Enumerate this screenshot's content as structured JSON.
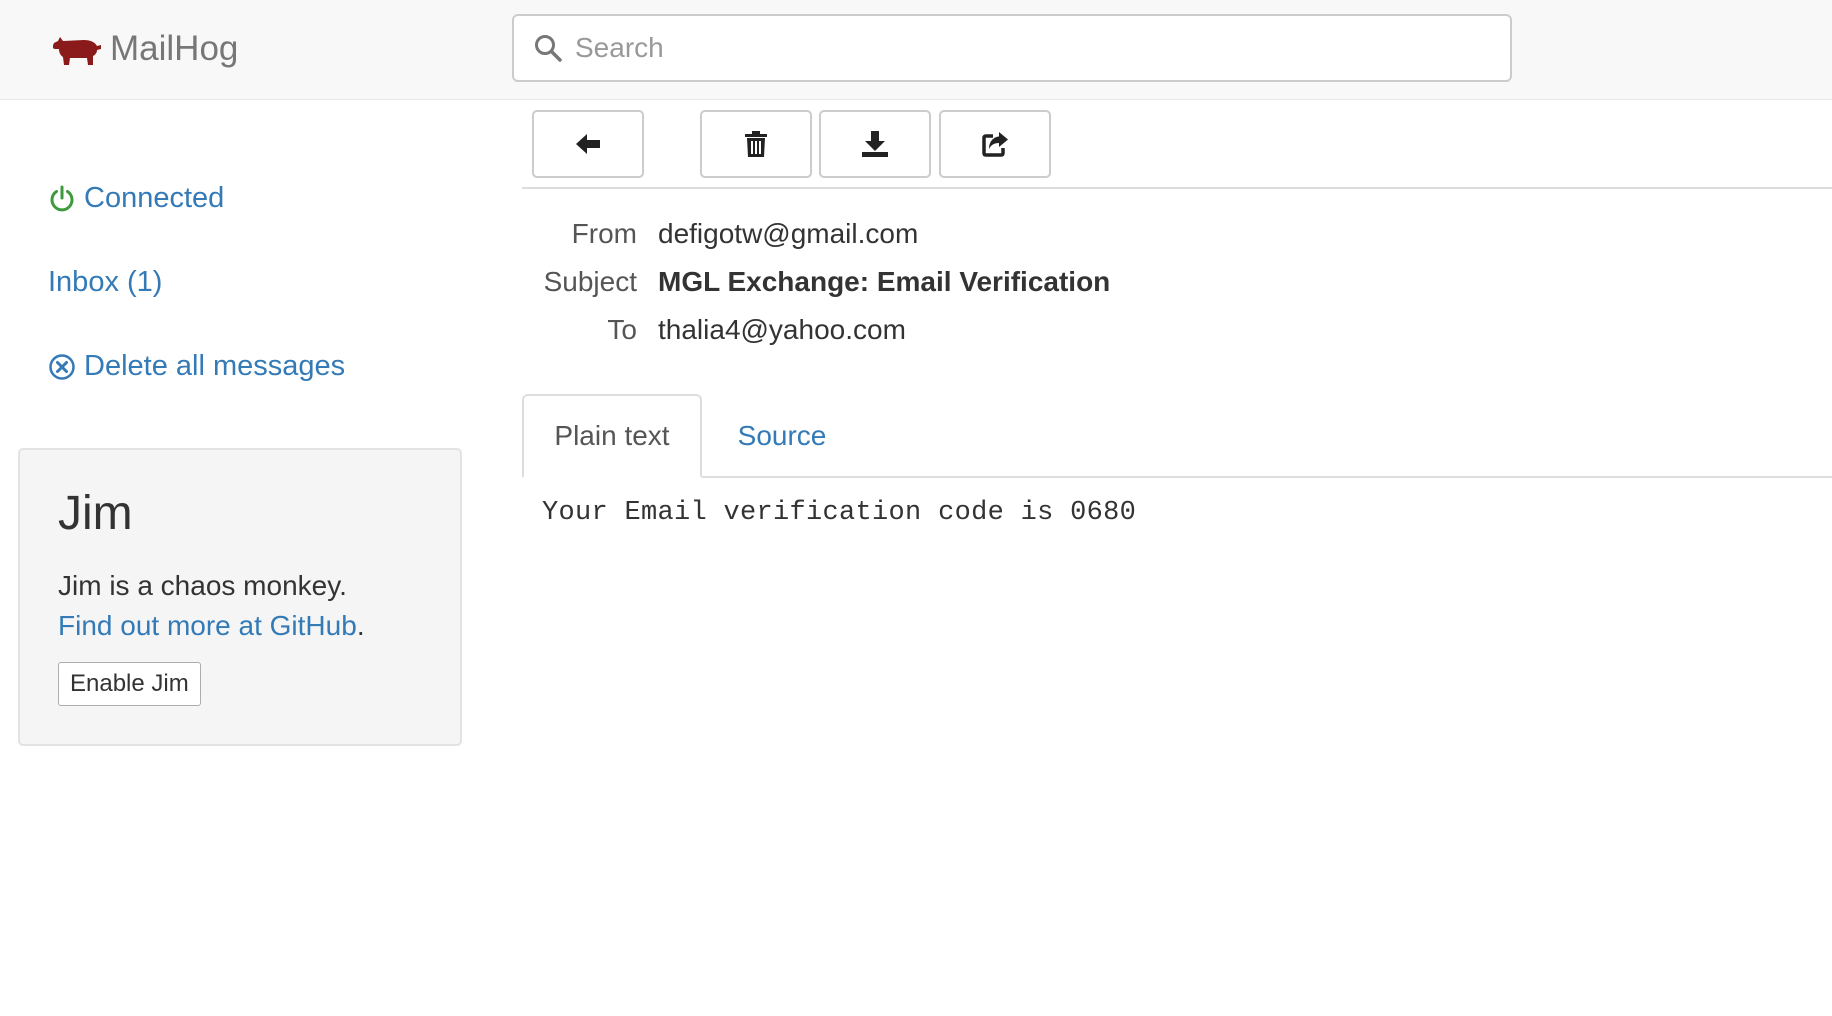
{
  "app": {
    "name": "MailHog",
    "logo_icon": "pig-icon",
    "logo_color": "#8b1a1a"
  },
  "search": {
    "placeholder": "Search",
    "value": ""
  },
  "sidebar": {
    "connection_status": "Connected",
    "connection_color": "#3c9a3c",
    "inbox_label": "Inbox (1)",
    "delete_all_label": "Delete all messages"
  },
  "jim": {
    "title": "Jim",
    "description": "Jim is a chaos monkey.",
    "link_text": "Find out more at GitHub",
    "link_suffix": ".",
    "button_label": "Enable Jim"
  },
  "toolbar": {
    "buttons": [
      {
        "name": "back",
        "icon": "arrow-left-icon"
      },
      {
        "name": "delete",
        "icon": "trash-icon"
      },
      {
        "name": "download",
        "icon": "download-icon"
      },
      {
        "name": "release",
        "icon": "share-icon"
      }
    ]
  },
  "message": {
    "from_label": "From",
    "from": "defigotw@gmail.com",
    "subject_label": "Subject",
    "subject": "MGL Exchange: Email Verification",
    "to_label": "To",
    "to": "thalia4@yahoo.com",
    "tabs": [
      "Plain text",
      "Source"
    ],
    "active_tab": "Plain text",
    "body": "Your Email verification code is 0680"
  },
  "colors": {
    "link": "#337ab7",
    "navbar_bg": "#f8f8f8",
    "panel_bg": "#f5f5f5"
  }
}
